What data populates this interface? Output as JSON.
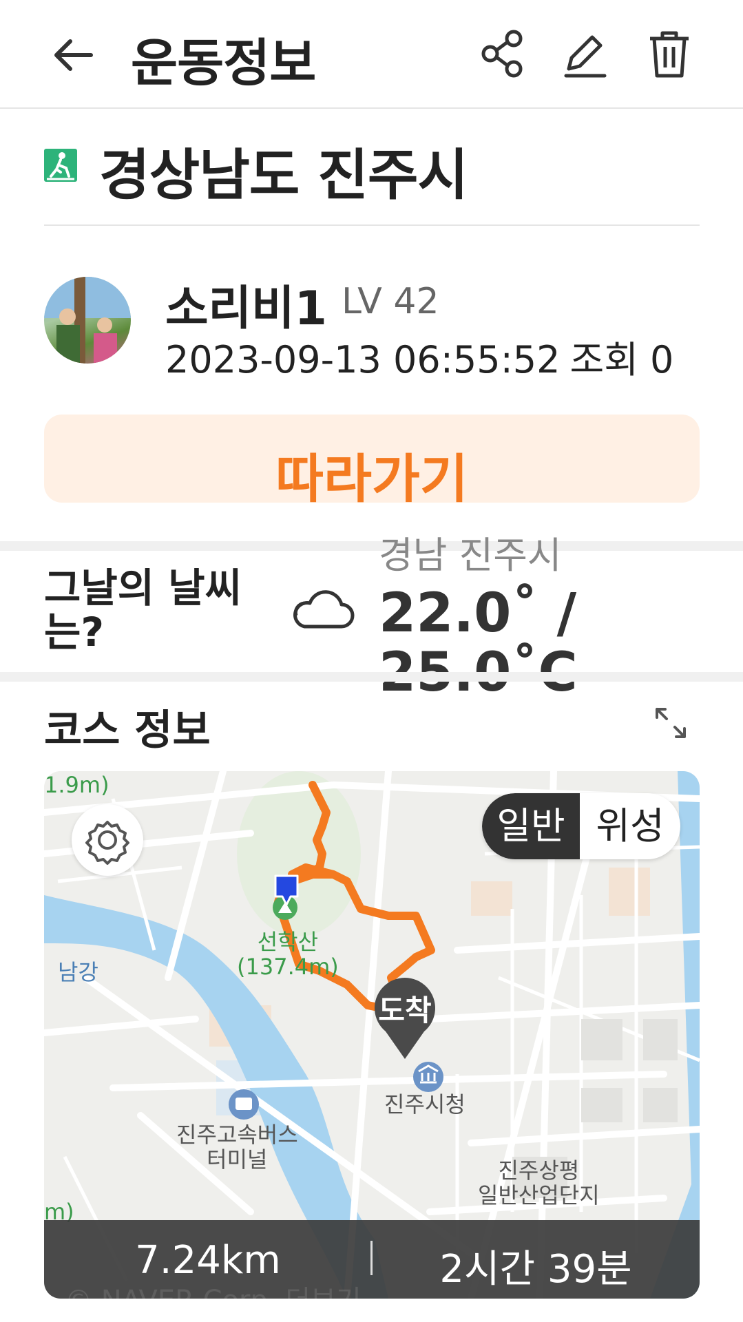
{
  "header": {
    "title": "운동정보",
    "icons": [
      "back-arrow-icon",
      "share-icon",
      "edit-icon",
      "trash-icon"
    ]
  },
  "location": {
    "title": "경상남도 진주시",
    "icon": "hiking-icon",
    "icon_color": "#2db37a"
  },
  "user": {
    "name": "소리비1",
    "level": "LV 42",
    "datetime": "2023-09-13 06:55:52",
    "views": "조회 0"
  },
  "follow_button": {
    "label": "따라가기",
    "color": "#f47a20",
    "background": "#fff0e4"
  },
  "weather": {
    "label": "그날의 날씨는?",
    "city": "경남 진주시",
    "temp": "22.0˚ / 25.0˚C",
    "icon": "cloud-icon"
  },
  "course": {
    "title": "코스 정보",
    "expand_icon": "expand-icon"
  },
  "map": {
    "toggle": {
      "normal": "일반",
      "satellite": "위성"
    },
    "labels": {
      "top_left_elev": "1.9m)",
      "mountain": "선학산\n(137.4m)",
      "river": "남강",
      "terminal": "진주고속버스\n터미널",
      "city_hall": "진주시청",
      "industrial": "진주상평\n일반산업단지",
      "edge": "m)"
    },
    "arrival": "도착",
    "route_color": "#f47a20",
    "water_color": "#a7d3f0",
    "copyright": "© NAVER Corp. 더보기"
  },
  "stats": {
    "distance": "7.24km",
    "duration": "2시간 39분"
  }
}
